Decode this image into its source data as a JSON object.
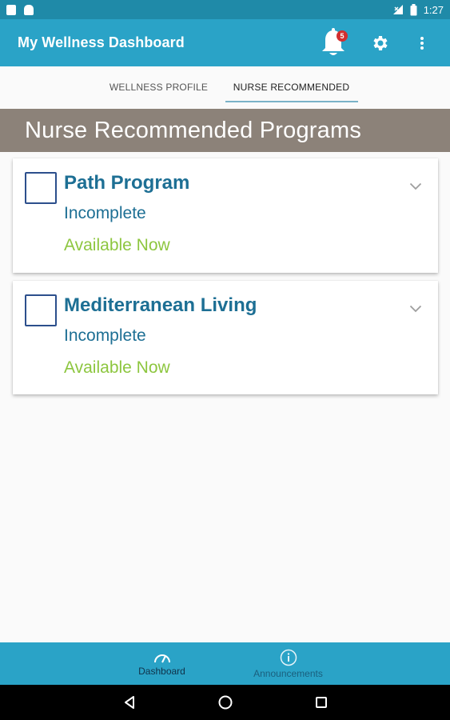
{
  "status_bar": {
    "time": "1:27"
  },
  "app_bar": {
    "title": "My Wellness Dashboard",
    "notification_count": "5"
  },
  "tabs": [
    {
      "label": "WELLNESS PROFILE",
      "active": false
    },
    {
      "label": "NURSE RECOMMENDED",
      "active": true
    }
  ],
  "section": {
    "title": "Nurse Recommended Programs"
  },
  "programs": [
    {
      "title": "Path Program",
      "status": "Incomplete",
      "availability": "Available Now"
    },
    {
      "title": "Mediterranean Living",
      "status": "Incomplete",
      "availability": "Available Now"
    }
  ],
  "bottom_nav": [
    {
      "label": "Dashboard",
      "icon": "speedometer-icon",
      "active": true
    },
    {
      "label": "Announcements",
      "icon": "info-icon",
      "active": false
    }
  ],
  "colors": {
    "status_bar": "#1f8aa8",
    "app_bar": "#2aa3c7",
    "section_header": "#8c8279",
    "title_blue": "#1d6f94",
    "available_green": "#8dc63f"
  }
}
